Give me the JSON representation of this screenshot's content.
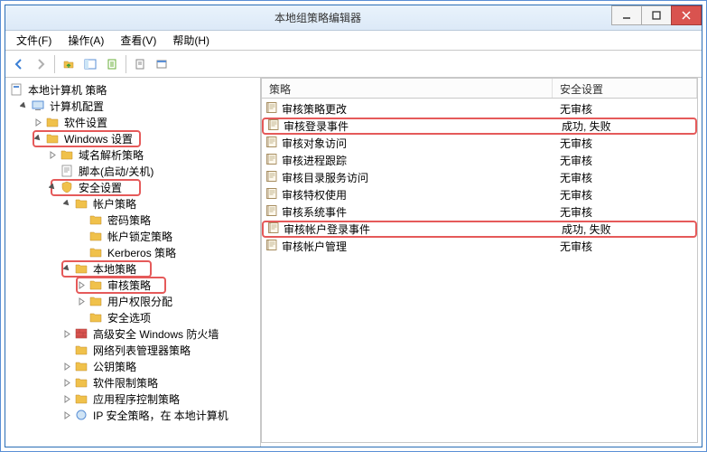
{
  "window": {
    "title": "本地组策略编辑器"
  },
  "menu": {
    "file": "文件(F)",
    "action": "操作(A)",
    "view": "查看(V)",
    "help": "帮助(H)"
  },
  "tree": {
    "root": "本地计算机 策略",
    "computer_config": "计算机配置",
    "software": "软件设置",
    "windows_settings": "Windows 设置",
    "dns": "域名解析策略",
    "scripts": "脚本(启动/关机)",
    "security": "安全设置",
    "account_policy": "帐户策略",
    "password_policy": "密码策略",
    "lockout_policy": "帐户锁定策略",
    "kerberos": "Kerberos 策略",
    "local_policy": "本地策略",
    "audit_policy": "审核策略",
    "user_rights": "用户权限分配",
    "sec_options": "安全选项",
    "adv_firewall": "高级安全 Windows 防火墙",
    "nlm": "网络列表管理器策略",
    "pubkey": "公钥策略",
    "srp": "软件限制策略",
    "app_ctrl": "应用程序控制策略",
    "ipsec": "IP 安全策略，在 本地计算机"
  },
  "list": {
    "header_policy": "策略",
    "header_setting": "安全设置",
    "rows": [
      {
        "policy": "审核策略更改",
        "setting": "无审核",
        "hl": false
      },
      {
        "policy": "审核登录事件",
        "setting": "成功, 失败",
        "hl": true
      },
      {
        "policy": "审核对象访问",
        "setting": "无审核",
        "hl": false
      },
      {
        "policy": "审核进程跟踪",
        "setting": "无审核",
        "hl": false
      },
      {
        "policy": "审核目录服务访问",
        "setting": "无审核",
        "hl": false
      },
      {
        "policy": "审核特权使用",
        "setting": "无审核",
        "hl": false
      },
      {
        "policy": "审核系统事件",
        "setting": "无审核",
        "hl": false
      },
      {
        "policy": "审核帐户登录事件",
        "setting": "成功, 失败",
        "hl": true
      },
      {
        "policy": "审核帐户管理",
        "setting": "无审核",
        "hl": false
      }
    ]
  }
}
